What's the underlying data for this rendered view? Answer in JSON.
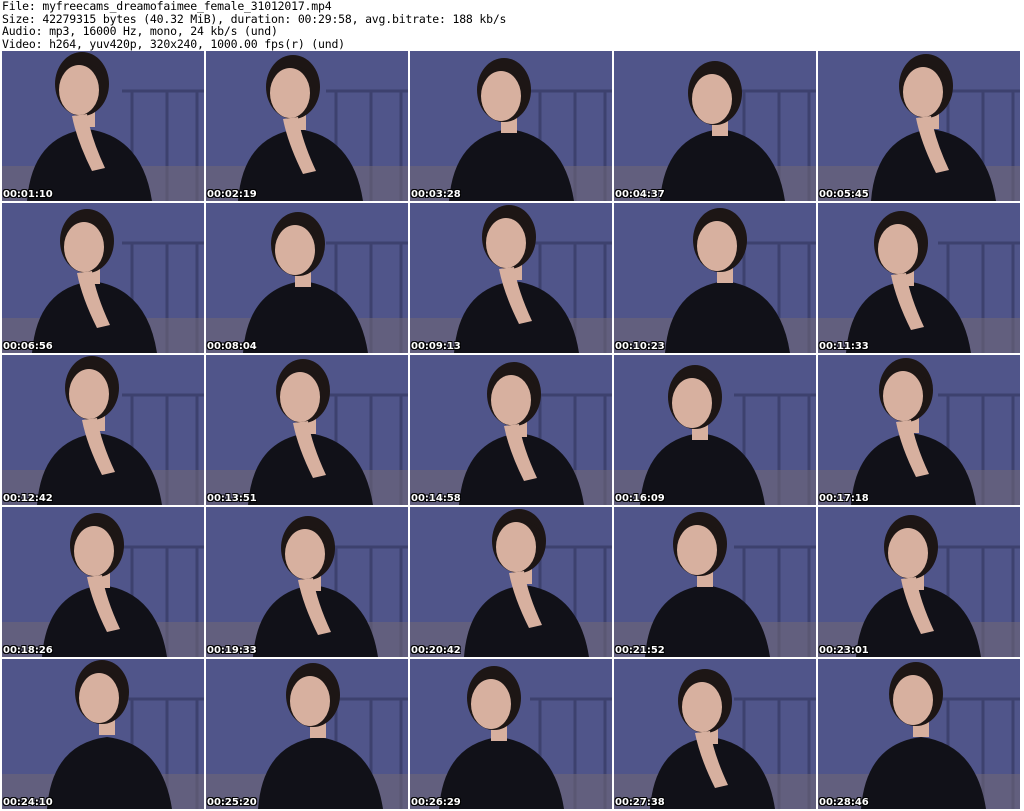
{
  "file_info": {
    "file": "File: myfreecams_dreamofaimee_female_31012017.mp4",
    "size": "Size: 42279315 bytes (40.32 MiB), duration: 00:29:58, avg.bitrate: 188 kb/s",
    "audio": "Audio: mp3, 16000 Hz, mono, 24 kb/s (und)",
    "video": "Video: h264, yuv420p, 320x240, 1000.00 fps(r) (und)"
  },
  "colors": {
    "background": "#4a4f83",
    "wall": "#565b92",
    "shirt": "#111118",
    "skin": "#d7b09f",
    "hair": "#1d1615"
  },
  "thumbnails": [
    {
      "timestamp": "00:01:10"
    },
    {
      "timestamp": "00:02:19"
    },
    {
      "timestamp": "00:03:28"
    },
    {
      "timestamp": "00:04:37"
    },
    {
      "timestamp": "00:05:45"
    },
    {
      "timestamp": "00:06:56"
    },
    {
      "timestamp": "00:08:04"
    },
    {
      "timestamp": "00:09:13"
    },
    {
      "timestamp": "00:10:23"
    },
    {
      "timestamp": "00:11:33"
    },
    {
      "timestamp": "00:12:42"
    },
    {
      "timestamp": "00:13:51"
    },
    {
      "timestamp": "00:14:58"
    },
    {
      "timestamp": "00:16:09"
    },
    {
      "timestamp": "00:17:18"
    },
    {
      "timestamp": "00:18:26"
    },
    {
      "timestamp": "00:19:33"
    },
    {
      "timestamp": "00:20:42"
    },
    {
      "timestamp": "00:21:52"
    },
    {
      "timestamp": "00:23:01"
    },
    {
      "timestamp": "00:24:10"
    },
    {
      "timestamp": "00:25:20"
    },
    {
      "timestamp": "00:26:29"
    },
    {
      "timestamp": "00:27:38"
    },
    {
      "timestamp": "00:28:46"
    }
  ]
}
